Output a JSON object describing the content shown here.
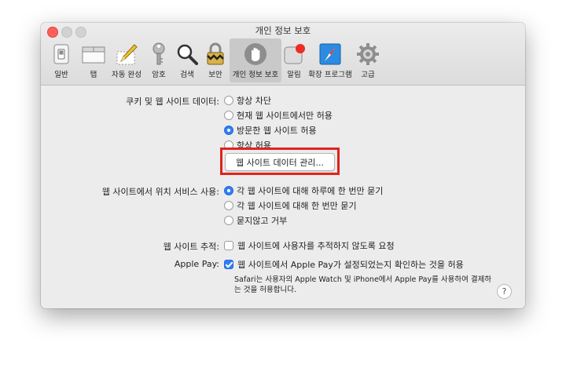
{
  "window": {
    "title": "개인 정보 보호"
  },
  "toolbar": {
    "items": [
      {
        "label": "일반",
        "icon": "general-switch-icon"
      },
      {
        "label": "탭",
        "icon": "tabs-icon"
      },
      {
        "label": "자동 완성",
        "icon": "autofill-pencil-icon"
      },
      {
        "label": "암호",
        "icon": "key-icon"
      },
      {
        "label": "검색",
        "icon": "magnifier-icon"
      },
      {
        "label": "보안",
        "icon": "padlock-icon"
      },
      {
        "label": "개인 정보 보호",
        "icon": "hand-icon",
        "selected": true
      },
      {
        "label": "알림",
        "icon": "notification-icon"
      },
      {
        "label": "확장 프로그램",
        "icon": "puzzle-icon"
      },
      {
        "label": "고급",
        "icon": "gear-icon"
      }
    ]
  },
  "cookies": {
    "label": "쿠키 및 웹 사이트 데이터:",
    "options": [
      "항상 차단",
      "현재 웹 사이트에서만 허용",
      "방문한 웹 사이트 허용",
      "항상 허용"
    ],
    "selected_index": 2,
    "manage_button": "웹 사이트 데이터 관리..."
  },
  "location": {
    "label": "웹 사이트에서 위치 서비스 사용:",
    "options": [
      "각 웹 사이트에 대해 하루에 한 번만 묻기",
      "각 웹 사이트에 대해 한 번만 묻기",
      "묻지않고 거부"
    ],
    "selected_index": 0
  },
  "tracking": {
    "label": "웹 사이트 추적:",
    "checkbox_label": "웹 사이트에 사용자를 추적하지 않도록 요청",
    "checked": false
  },
  "applepay": {
    "label": "Apple Pay:",
    "checkbox_label": "웹 사이트에서 Apple Pay가 설정되었는지 확인하는 것을 허용",
    "checked": true,
    "note": "Safari는 사용자의 Apple Watch 및 iPhone에서 Apple Pay를 사용하여 결제하는 것을 허용합니다."
  },
  "help": {
    "label": "?"
  },
  "colors": {
    "accent": "#2f7ff6",
    "highlight": "#e1231d"
  }
}
